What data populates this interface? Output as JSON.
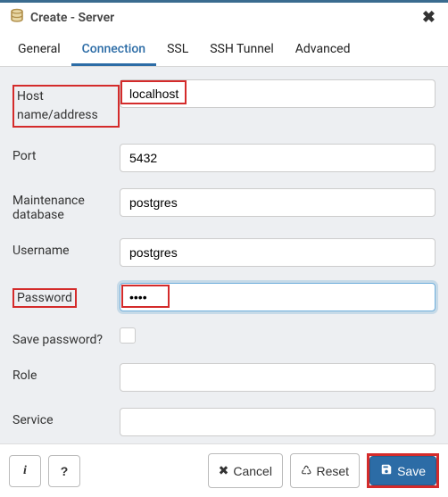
{
  "title": "Create - Server",
  "tabs": {
    "general": "General",
    "connection": "Connection",
    "ssl": "SSL",
    "ssh": "SSH Tunnel",
    "advanced": "Advanced"
  },
  "labels": {
    "host": "Host name/address",
    "port": "Port",
    "maintenance_db": "Maintenance database",
    "username": "Username",
    "password": "Password",
    "save_password": "Save password?",
    "role": "Role",
    "service": "Service"
  },
  "fields": {
    "host": "localhost",
    "port": "5432",
    "maintenance_db": "postgres",
    "username": "postgres",
    "password": "••••",
    "role": "",
    "service": ""
  },
  "buttons": {
    "info": "i",
    "help": "?",
    "cancel": "Cancel",
    "reset": "Reset",
    "save": "Save"
  }
}
